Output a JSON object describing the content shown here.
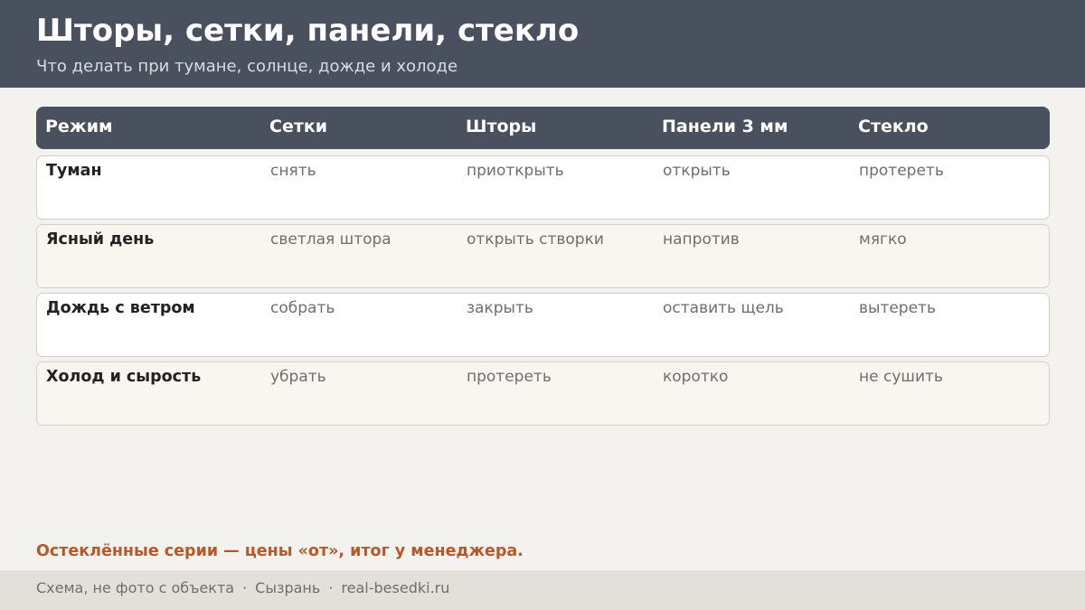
{
  "header": {
    "title": "Шторы, сетки, панели, стекло",
    "subtitle": "Что делать при тумане, солнце, дожде и холоде"
  },
  "table": {
    "columns": [
      "Режим",
      "Сетки",
      "Шторы",
      "Панели 3 мм",
      "Стекло"
    ],
    "rows": [
      [
        "Туман",
        "снять",
        "приоткрыть",
        "открыть",
        "протереть"
      ],
      [
        "Ясный день",
        "светлая штора",
        "открыть створки",
        "напротив",
        "мягко"
      ],
      [
        "Дождь с ветром",
        "собрать",
        "закрыть",
        "оставить щель",
        "вытереть"
      ],
      [
        "Холод и сырость",
        "убрать",
        "протереть",
        "коротко",
        "не сушить"
      ]
    ]
  },
  "note": "Остеклённые серии — цены «от», итог у менеджера.",
  "footer": {
    "parts": [
      "Схема, не фото с объекта",
      "Сызрань",
      "real-besedki.ru"
    ],
    "separator": "·"
  },
  "colors": {
    "header_bg": "#48515d",
    "accent": "#b5592b",
    "page_bg": "#f4f2ee"
  }
}
